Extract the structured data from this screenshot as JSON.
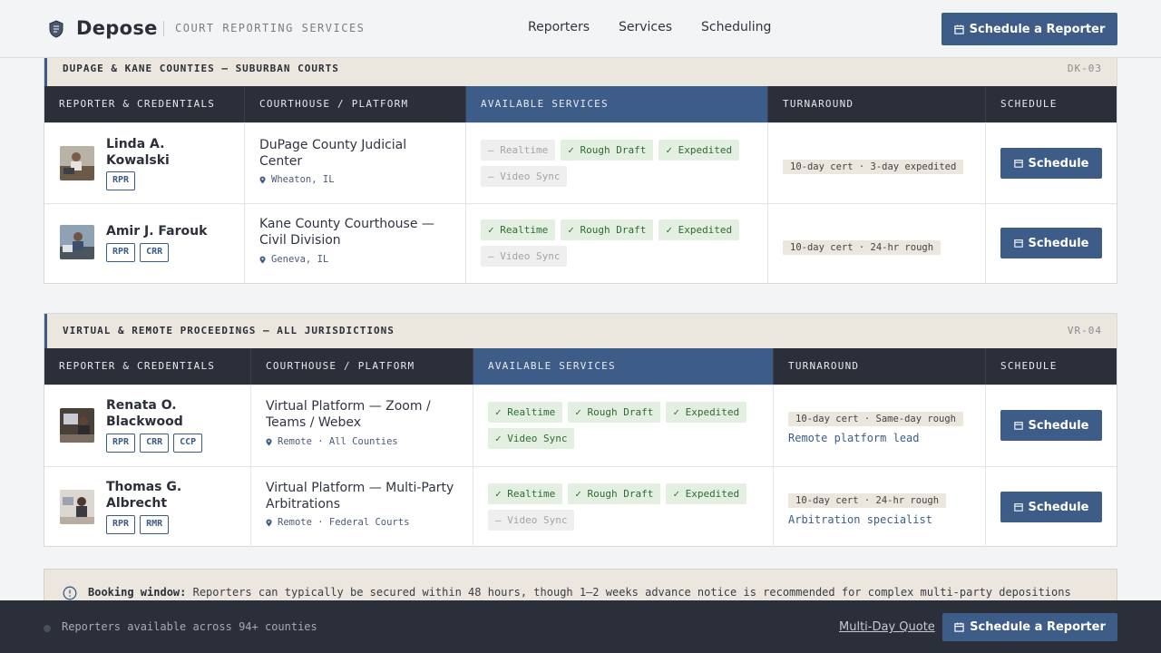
{
  "header": {
    "brand": "Depose",
    "tagline": "COURT REPORTING SERVICES",
    "nav": [
      "Reporters",
      "Services",
      "Scheduling"
    ],
    "cta": "Schedule a Reporter"
  },
  "table_headers": [
    "REPORTER & CREDENTIALS",
    "COURTHOUSE / PLATFORM",
    "AVAILABLE SERVICES",
    "TURNAROUND",
    "SCHEDULE"
  ],
  "sections": [
    {
      "title": "DUPAGE & KANE COUNTIES — SUBURBAN COURTS",
      "code": "DK-03",
      "rows": [
        {
          "name_line1": "Linda A.",
          "name_line2": "Kowalski",
          "creds": [
            "RPR"
          ],
          "court_line1": "DuPage County Judicial",
          "court_line2": "Center",
          "location": "Wheaton, IL",
          "services": [
            {
              "label": "– Realtime",
              "on": false
            },
            {
              "label": "✓ Rough Draft",
              "on": true
            },
            {
              "label": "✓ Expedited",
              "on": true
            },
            {
              "label": "– Video Sync",
              "on": false
            }
          ],
          "turnaround": "10-day cert · 3-day expedited",
          "note": "",
          "button": "Schedule"
        },
        {
          "name_line1": "Amir J. Farouk",
          "name_line2": "",
          "creds": [
            "RPR",
            "CRR"
          ],
          "court_line1": "Kane County Courthouse —",
          "court_line2": "Civil Division",
          "location": "Geneva, IL",
          "services": [
            {
              "label": "✓ Realtime",
              "on": true
            },
            {
              "label": "✓ Rough Draft",
              "on": true
            },
            {
              "label": "✓ Expedited",
              "on": true
            },
            {
              "label": "– Video Sync",
              "on": false
            }
          ],
          "turnaround": "10-day cert · 24-hr rough",
          "note": "",
          "button": "Schedule"
        }
      ]
    },
    {
      "title": "VIRTUAL & REMOTE PROCEEDINGS — ALL JURISDICTIONS",
      "code": "VR-04",
      "rows": [
        {
          "name_line1": "Renata O.",
          "name_line2": "Blackwood",
          "creds": [
            "RPR",
            "CRR",
            "CCP"
          ],
          "court_line1": "Virtual Platform — Zoom /",
          "court_line2": "Teams / Webex",
          "location": "Remote · All Counties",
          "services": [
            {
              "label": "✓ Realtime",
              "on": true
            },
            {
              "label": "✓ Rough Draft",
              "on": true
            },
            {
              "label": "✓ Expedited",
              "on": true
            },
            {
              "label": "✓ Video Sync",
              "on": true
            }
          ],
          "turnaround": "10-day cert · Same-day rough",
          "note": "Remote platform lead",
          "button": "Schedule"
        },
        {
          "name_line1": "Thomas G.",
          "name_line2": "Albrecht",
          "creds": [
            "RPR",
            "RMR"
          ],
          "court_line1": "Virtual Platform — Multi-Party",
          "court_line2": "Arbitrations",
          "location": "Remote · Federal Courts",
          "services": [
            {
              "label": "✓ Realtime",
              "on": true
            },
            {
              "label": "✓ Rough Draft",
              "on": true
            },
            {
              "label": "✓ Expedited",
              "on": true
            },
            {
              "label": "– Video Sync",
              "on": false
            }
          ],
          "turnaround": "10-day cert · 24-hr rough",
          "note": "Arbitration specialist",
          "button": "Schedule"
        }
      ]
    }
  ],
  "notice": {
    "label": "Booking window:",
    "text": "Reporters can typically be secured within 48 hours, though 1–2 weeks advance notice is recommended for complex multi-party depositions"
  },
  "footer": {
    "status": "Reporters available across 94+ counties",
    "quote_link": "Multi-Day Quote",
    "cta": "Schedule a Reporter"
  },
  "colors": {
    "accent": "#3e5c88",
    "dark": "#2b2f3a",
    "sand": "#ebe6de",
    "chip_on_bg": "#e3efe1",
    "chip_on_text": "#2f6b33"
  },
  "icons": [
    "shield-logo-icon",
    "calendar-icon",
    "map-pin-icon",
    "info-clock-icon"
  ]
}
